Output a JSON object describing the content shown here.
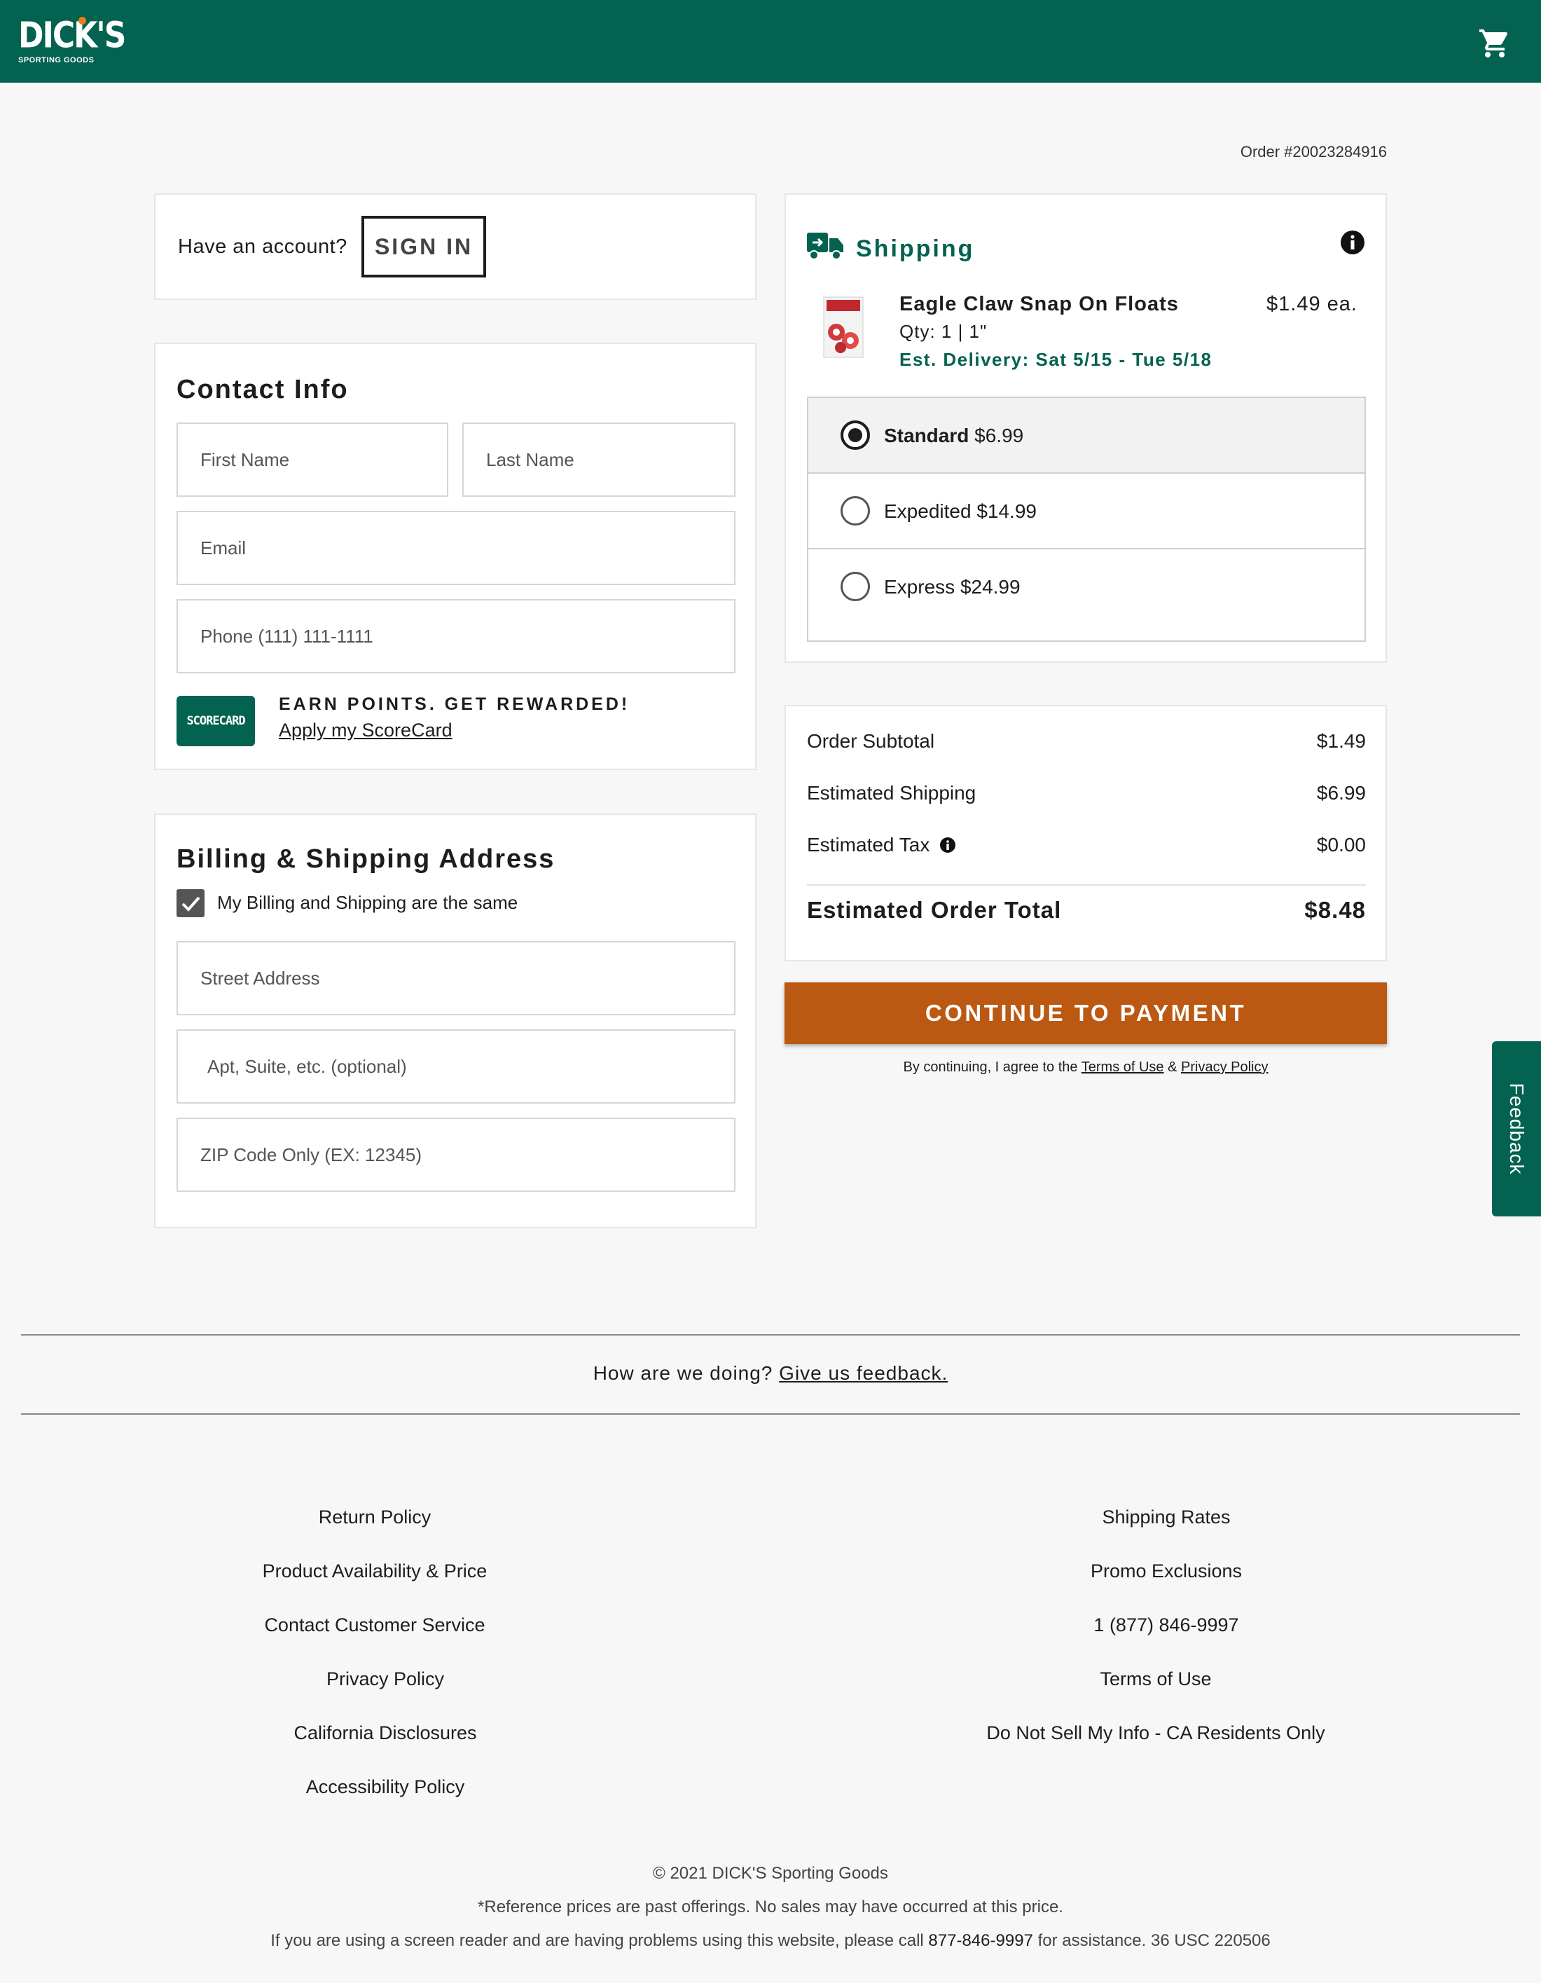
{
  "header": {
    "logo_text": "DICK'S",
    "logo_sub": "SPORTING GOODS",
    "brand_color": "#046250",
    "cart_icon": "cart-icon"
  },
  "order_number": "Order #20023284916",
  "signin": {
    "question": "Have an account?",
    "button": "SIGN IN"
  },
  "contact": {
    "title": "Contact Info",
    "first_name_placeholder": "First Name",
    "last_name_placeholder": "Last Name",
    "email_placeholder": "Email",
    "phone_placeholder": "Phone (111) 111-1111",
    "scorecard_logo": "SCORECARD",
    "earn_points": "EARN POINTS. GET REWARDED!",
    "apply_link": "Apply my ScoreCard"
  },
  "billing": {
    "title": "Billing & Shipping Address",
    "same_checkbox_label": "My Billing and Shipping are the same",
    "same_checked": true,
    "street_placeholder": "Street Address",
    "apt_placeholder": "Apt, Suite, etc. (optional)",
    "zip_placeholder": "ZIP Code Only (EX: 12345)"
  },
  "shipping": {
    "title": "Shipping",
    "product": {
      "name": "Eagle Claw Snap On Floats",
      "price": "$1.49 ea.",
      "qty": "Qty: 1 | 1\"",
      "est_delivery": "Est. Delivery: Sat 5/15 - Tue 5/18"
    },
    "options": [
      {
        "name": "Standard",
        "price": "$6.99",
        "selected": true
      },
      {
        "name": "Expedited",
        "price": "$14.99",
        "selected": false
      },
      {
        "name": "Express",
        "price": "$24.99",
        "selected": false
      }
    ]
  },
  "summary": {
    "subtotal_label": "Order Subtotal",
    "subtotal_value": "$1.49",
    "shipping_label": "Estimated Shipping",
    "shipping_value": "$6.99",
    "tax_label": "Estimated Tax",
    "tax_value": "$0.00",
    "total_label": "Estimated Order Total",
    "total_value": "$8.48"
  },
  "continue_button": "CONTINUE TO PAYMENT",
  "accent_color": "#bb5811",
  "agree": {
    "prefix": "By continuing, I agree to the",
    "terms": "Terms of Use",
    "amp": "&",
    "privacy": "Privacy Policy"
  },
  "feedback_tab": "Feedback",
  "feedback_prompt": {
    "question": "How are we doing?",
    "link": "Give us feedback."
  },
  "footer": {
    "left_links": [
      "Return Policy",
      "Product Availability & Price",
      "Contact Customer Service",
      "Privacy Policy",
      "California Disclosures",
      "Accessibility Policy"
    ],
    "right_links": [
      "Shipping Rates",
      "Promo Exclusions",
      "1 (877) 846-9997",
      "Terms of Use",
      "Do Not Sell My Info - CA Residents Only"
    ],
    "copyright": "© 2021 DICK'S Sporting Goods",
    "reference_note": "*Reference prices are past offerings. No sales may have occurred at this price.",
    "screen_reader_prefix": "If you are using a screen reader and are having problems using this website, please call",
    "screen_reader_phone": "877-846-9997",
    "screen_reader_suffix": "for assistance. 36 USC 220506"
  }
}
